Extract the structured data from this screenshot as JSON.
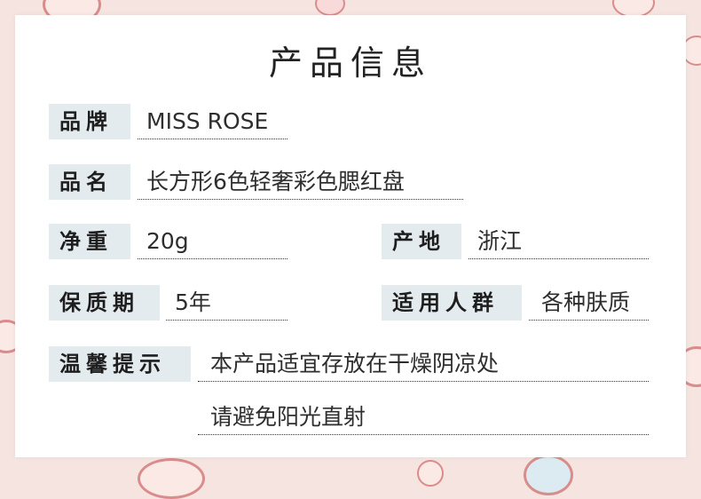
{
  "title": "产品信息",
  "rows": {
    "brand": {
      "label": "品牌",
      "value": "MISS ROSE"
    },
    "name": {
      "label": "品名",
      "value": "长方形6色轻奢彩色腮红盘"
    },
    "weight": {
      "label": "净重",
      "value": "20g"
    },
    "origin": {
      "label": "产地",
      "value": "浙江"
    },
    "shelf_life": {
      "label": "保质期",
      "value": "5年"
    },
    "skin_type": {
      "label": "适用人群",
      "value": "各种肤质"
    },
    "tips": {
      "label": "温馨提示",
      "line1": "本产品适宜存放在干燥阴凉处",
      "line2": "请避免阳光直射"
    }
  }
}
